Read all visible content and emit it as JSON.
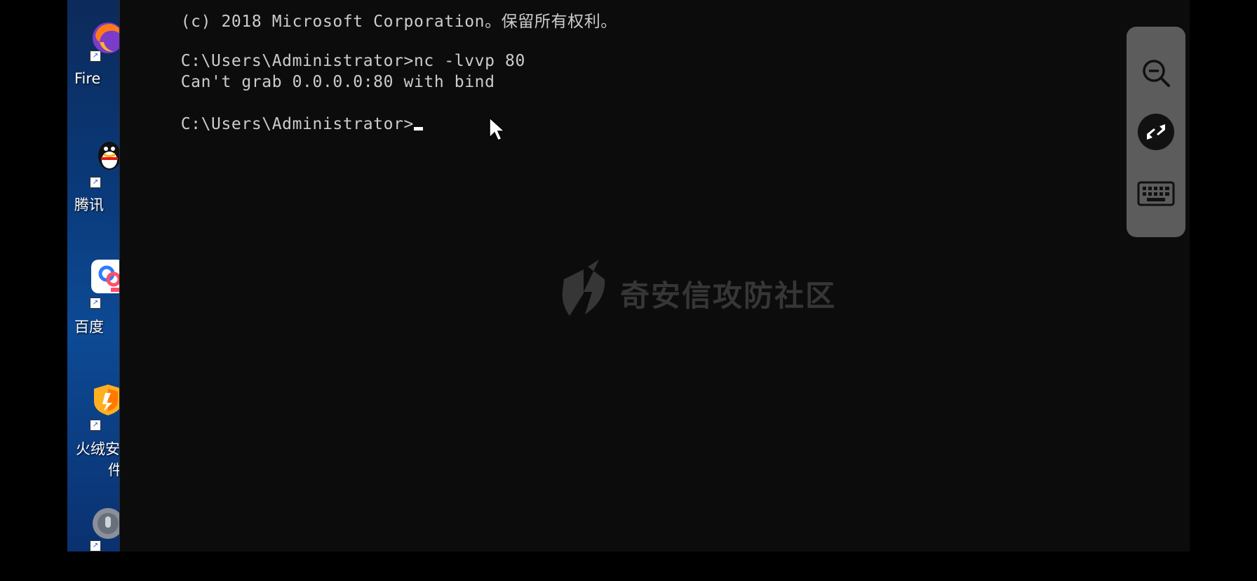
{
  "terminal": {
    "lines": [
      "(c) 2018 Microsoft Corporation。保留所有权利。",
      "C:\\Users\\Administrator>nc -lvvp 80",
      "Can't grab 0.0.0.0:80 with bind",
      "C:\\Users\\Administrator>"
    ]
  },
  "desktop": {
    "icons": [
      {
        "name": "firefox",
        "label": "Fire"
      },
      {
        "name": "qq",
        "label": "腾讯"
      },
      {
        "name": "baidu",
        "label": "百度"
      },
      {
        "name": "huorong",
        "label": "火绒安",
        "label2": "件"
      },
      {
        "name": "unknown-app",
        "label": ""
      }
    ]
  },
  "watermark": {
    "text": "奇安信攻防社区"
  },
  "floating_toolbar": {
    "items": [
      "zoom-out-icon",
      "remote-desktop-icon",
      "keyboard-icon"
    ]
  },
  "colors": {
    "console_bg": "#0c0c0c",
    "console_text": "#cccccc",
    "toolbar_bg": "#5c5c5c",
    "desktop_bg": "#0d4a95"
  }
}
